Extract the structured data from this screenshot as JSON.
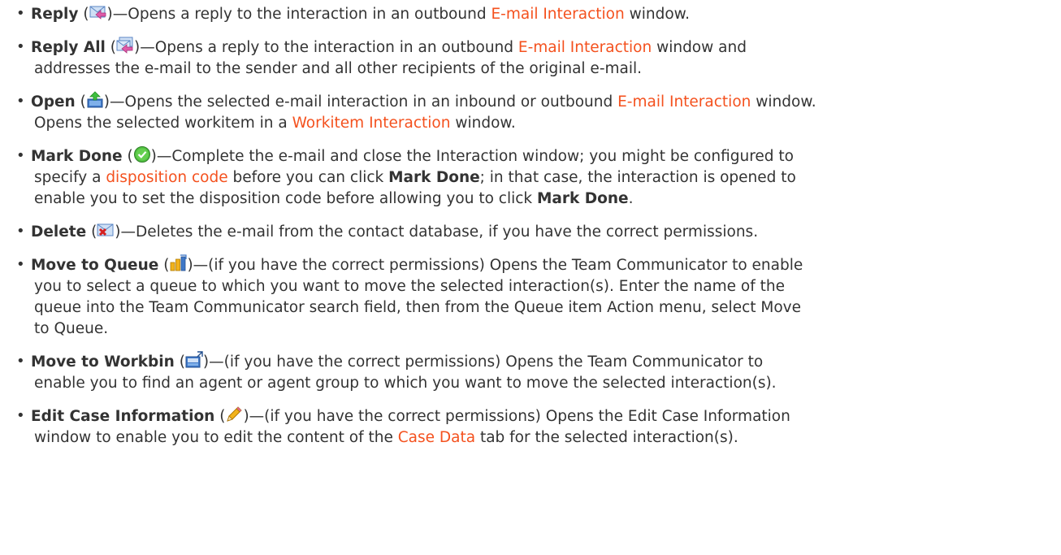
{
  "items": [
    {
      "term": "Reply",
      "icon": "reply-icon",
      "line1_text": "—Opens a reply to the interaction in an outbound ",
      "line1_link": "E-mail Interaction",
      "line1_end": " window."
    },
    {
      "term": "Reply All",
      "icon": "reply-all-icon",
      "line1_text": "—Opens a reply to the interaction in an outbound ",
      "line1_link": "E-mail Interaction",
      "line1_end": " window and",
      "line2": "addresses the e-mail to the sender and all other recipients of the original e-mail."
    },
    {
      "term": "Open",
      "icon": "open-icon",
      "line1_text": "—Opens the selected e-mail interaction in an inbound or outbound ",
      "line1_link": "E-mail Interaction",
      "line1_end": " window.",
      "line2_text": "Opens the selected workitem in a ",
      "line2_link": "Workitem Interaction",
      "line2_end": " window."
    },
    {
      "term": "Mark Done",
      "icon": "mark-done-icon",
      "line1": "—Complete the e-mail and close the Interaction window; you might be configured to",
      "line2_text": "specify a ",
      "line2_link": "disposition code",
      "line2_mid": " before you can click ",
      "line2_bold": "Mark Done",
      "line2_end": "; in that case, the interaction is opened to",
      "line3_text": "enable you to set the disposition code before allowing you to click ",
      "line3_bold": "Mark Done",
      "line3_end": "."
    },
    {
      "term": "Delete",
      "icon": "delete-icon",
      "line1": "—Deletes the e-mail from the contact database, if you have the correct permissions."
    },
    {
      "term": "Move to Queue",
      "icon": "move-to-queue-icon",
      "line1": "—(if you have the correct permissions) Opens the Team Communicator to enable",
      "line2": "you to select a queue to which you want to move the selected interaction(s). Enter the name of the",
      "line3": "queue into the Team Communicator search field, then from the Queue item Action menu, select Move",
      "line4": "to Queue."
    },
    {
      "term": "Move to Workbin",
      "icon": "move-to-workbin-icon",
      "line1": "—(if you have the correct permissions) Opens the Team Communicator to",
      "line2": "enable you to find an agent or agent group to which you want to move the selected interaction(s)."
    },
    {
      "term": "Edit Case Information",
      "icon": "edit-case-information-icon",
      "line1": "—(if you have the correct permissions) Opens the Edit Case Information",
      "line2_text": "window to enable you to edit the content of the ",
      "line2_link": "Case Data",
      "line2_end": " tab for the selected interaction(s)."
    }
  ],
  "colors": {
    "text": "#333333",
    "link": "#f4511e"
  }
}
